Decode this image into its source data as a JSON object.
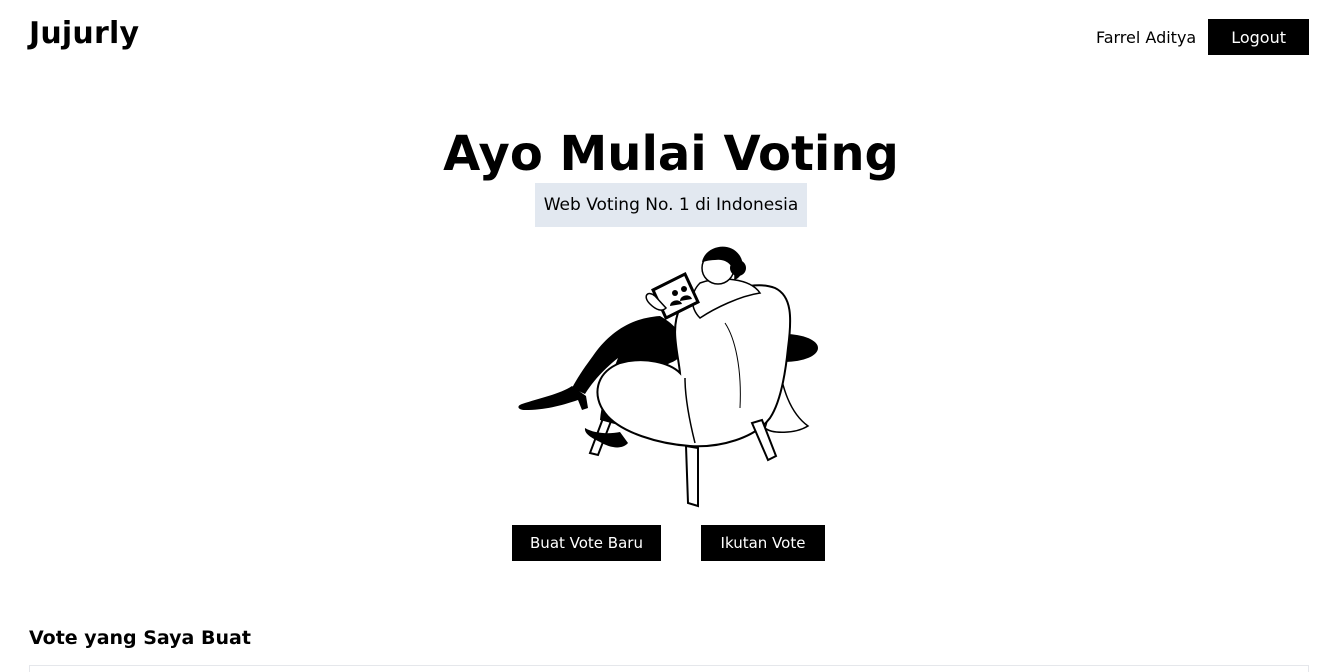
{
  "navbar": {
    "brand": "Jujurly",
    "username": "Farrel Aditya",
    "logout_label": "Logout"
  },
  "hero": {
    "title": "Ayo Mulai Voting",
    "tagline": "Web Voting No. 1 di Indonesia",
    "illustration_icon": "woman-on-armchair-with-tablet-illustration"
  },
  "actions": {
    "create_label": "Buat Vote Baru",
    "join_label": "Ikutan Vote"
  },
  "section": {
    "my_votes_title": "Vote yang Saya Buat"
  },
  "colors": {
    "primary": "#000000",
    "tagline_bg": "#e2e8f0",
    "background": "#ffffff"
  }
}
